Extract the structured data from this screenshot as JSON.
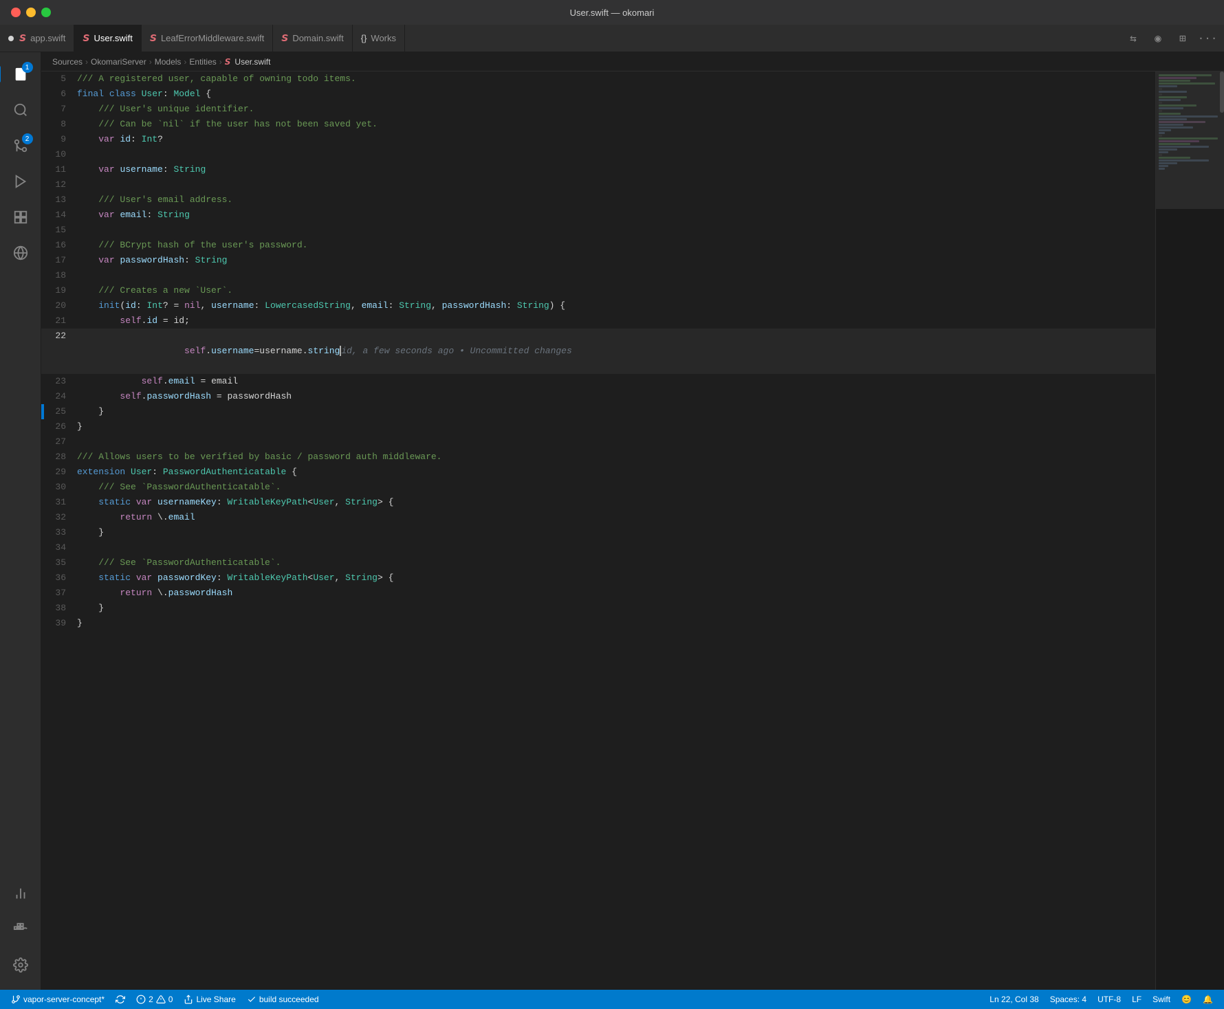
{
  "titleBar": {
    "title": "User.swift — okomari"
  },
  "tabs": [
    {
      "id": "app",
      "label": "app.swift",
      "icon": "swift",
      "dirty": true,
      "active": false
    },
    {
      "id": "user",
      "label": "User.swift",
      "icon": "swift",
      "dirty": false,
      "active": true
    },
    {
      "id": "leaferror",
      "label": "LeafErrorMiddleware.swift",
      "icon": "swift",
      "dirty": false,
      "active": false
    },
    {
      "id": "domain",
      "label": "Domain.swift",
      "icon": "swift",
      "dirty": false,
      "active": false
    },
    {
      "id": "works",
      "label": "Works",
      "icon": "braces",
      "dirty": false,
      "active": false
    }
  ],
  "breadcrumb": {
    "items": [
      "Sources",
      "OkomariServer",
      "Models",
      "Entities",
      "User.swift"
    ]
  },
  "activityBar": {
    "items": [
      {
        "id": "explorer",
        "icon": "📄",
        "badge": "1",
        "active": true
      },
      {
        "id": "search",
        "icon": "🔍",
        "badge": null,
        "active": false
      },
      {
        "id": "git",
        "icon": "⎇",
        "badge": "2",
        "active": false
      },
      {
        "id": "debug",
        "icon": "🔴",
        "badge": null,
        "active": false
      },
      {
        "id": "extensions",
        "icon": "⊞",
        "badge": null,
        "active": false
      },
      {
        "id": "remote",
        "icon": "🌐",
        "badge": null,
        "active": false
      }
    ],
    "bottom": [
      {
        "id": "settings",
        "icon": "⚙",
        "active": false
      }
    ]
  },
  "code": {
    "lines": [
      {
        "num": 5,
        "tokens": [
          {
            "t": "comment",
            "v": "/// A registered user, capable of owning todo items."
          }
        ]
      },
      {
        "num": 6,
        "tokens": [
          {
            "t": "kw2",
            "v": "final "
          },
          {
            "t": "kw2",
            "v": "class "
          },
          {
            "t": "type",
            "v": "User"
          },
          {
            "t": "plain",
            "v": ": "
          },
          {
            "t": "type",
            "v": "Model"
          },
          {
            "t": "plain",
            "v": " {"
          }
        ]
      },
      {
        "num": 7,
        "tokens": [
          {
            "t": "comment",
            "v": "    /// User's unique identifier."
          }
        ]
      },
      {
        "num": 8,
        "tokens": [
          {
            "t": "comment",
            "v": "    /// Can be `nil` if the user has not been saved yet."
          }
        ]
      },
      {
        "num": 9,
        "tokens": [
          {
            "t": "plain",
            "v": "    "
          },
          {
            "t": "kw",
            "v": "var "
          },
          {
            "t": "prop",
            "v": "id"
          },
          {
            "t": "plain",
            "v": ": "
          },
          {
            "t": "type",
            "v": "Int"
          },
          {
            "t": "plain",
            "v": "?"
          }
        ]
      },
      {
        "num": 10,
        "tokens": []
      },
      {
        "num": 11,
        "tokens": [
          {
            "t": "plain",
            "v": "    "
          },
          {
            "t": "kw",
            "v": "var "
          },
          {
            "t": "prop",
            "v": "username"
          },
          {
            "t": "plain",
            "v": ": "
          },
          {
            "t": "type",
            "v": "String"
          }
        ]
      },
      {
        "num": 12,
        "tokens": []
      },
      {
        "num": 13,
        "tokens": [
          {
            "t": "comment",
            "v": "    /// User's email address."
          }
        ]
      },
      {
        "num": 14,
        "tokens": [
          {
            "t": "plain",
            "v": "    "
          },
          {
            "t": "kw",
            "v": "var "
          },
          {
            "t": "prop",
            "v": "email"
          },
          {
            "t": "plain",
            "v": ": "
          },
          {
            "t": "type",
            "v": "String"
          }
        ]
      },
      {
        "num": 15,
        "tokens": []
      },
      {
        "num": 16,
        "tokens": [
          {
            "t": "comment",
            "v": "    /// BCrypt hash of the user's password."
          }
        ]
      },
      {
        "num": 17,
        "tokens": [
          {
            "t": "plain",
            "v": "    "
          },
          {
            "t": "kw",
            "v": "var "
          },
          {
            "t": "prop",
            "v": "passwordHash"
          },
          {
            "t": "plain",
            "v": ": "
          },
          {
            "t": "type",
            "v": "String"
          }
        ]
      },
      {
        "num": 18,
        "tokens": []
      },
      {
        "num": 19,
        "tokens": [
          {
            "t": "comment",
            "v": "    /// Creates a new `User`."
          }
        ]
      },
      {
        "num": 20,
        "tokens": [
          {
            "t": "plain",
            "v": "    "
          },
          {
            "t": "kw2",
            "v": "init"
          },
          {
            "t": "plain",
            "v": "("
          },
          {
            "t": "param",
            "v": "id"
          },
          {
            "t": "plain",
            "v": ": "
          },
          {
            "t": "type",
            "v": "Int"
          },
          {
            "t": "plain",
            "v": "? = "
          },
          {
            "t": "kw",
            "v": "nil"
          },
          {
            "t": "plain",
            "v": ", "
          },
          {
            "t": "param",
            "v": "username"
          },
          {
            "t": "plain",
            "v": ": "
          },
          {
            "t": "type",
            "v": "LowercasedString"
          },
          {
            "t": "plain",
            "v": ", "
          },
          {
            "t": "param",
            "v": "email"
          },
          {
            "t": "plain",
            "v": ": "
          },
          {
            "t": "type",
            "v": "String"
          },
          {
            "t": "plain",
            "v": ", "
          },
          {
            "t": "param",
            "v": "passwordHash"
          },
          {
            "t": "plain",
            "v": ": "
          },
          {
            "t": "type",
            "v": "String"
          },
          {
            "t": "plain",
            "v": ") {"
          }
        ]
      },
      {
        "num": 21,
        "tokens": [
          {
            "t": "plain",
            "v": "        "
          },
          {
            "t": "kw",
            "v": "self"
          },
          {
            "t": "plain",
            "v": "."
          },
          {
            "t": "prop",
            "v": "id"
          },
          {
            "t": "plain",
            "v": " = id;"
          }
        ]
      },
      {
        "num": 22,
        "active": true,
        "tokens": [
          {
            "t": "plain",
            "v": "        "
          },
          {
            "t": "kw",
            "v": "self"
          },
          {
            "t": "plain",
            "v": "."
          },
          {
            "t": "prop",
            "v": "username"
          },
          {
            "t": "plain",
            "v": "=username."
          },
          {
            "t": "prop",
            "v": "string"
          },
          {
            "t": "cursor",
            "v": ""
          },
          {
            "t": "ghost",
            "v": "id, a few seconds ago • Uncommitted changes"
          }
        ]
      },
      {
        "num": 23,
        "tokens": [
          {
            "t": "plain",
            "v": "            "
          },
          {
            "t": "kw",
            "v": "self"
          },
          {
            "t": "plain",
            "v": "."
          },
          {
            "t": "prop",
            "v": "email"
          },
          {
            "t": "plain",
            "v": " = email"
          }
        ]
      },
      {
        "num": 24,
        "tokens": [
          {
            "t": "plain",
            "v": "        "
          },
          {
            "t": "kw",
            "v": "self"
          },
          {
            "t": "plain",
            "v": "."
          },
          {
            "t": "prop",
            "v": "passwordHash"
          },
          {
            "t": "plain",
            "v": " = passwordHash"
          }
        ]
      },
      {
        "num": 25,
        "tokens": [
          {
            "t": "plain",
            "v": "    }"
          }
        ],
        "gutter": true
      },
      {
        "num": 26,
        "tokens": [
          {
            "t": "plain",
            "v": "}"
          }
        ]
      },
      {
        "num": 27,
        "tokens": []
      },
      {
        "num": 28,
        "tokens": [
          {
            "t": "comment",
            "v": "/// Allows users to be verified by basic / password auth middleware."
          }
        ]
      },
      {
        "num": 29,
        "tokens": [
          {
            "t": "kw2",
            "v": "extension "
          },
          {
            "t": "type",
            "v": "User"
          },
          {
            "t": "plain",
            "v": ": "
          },
          {
            "t": "type",
            "v": "PasswordAuthenticatable"
          },
          {
            "t": "plain",
            "v": " {"
          }
        ]
      },
      {
        "num": 30,
        "tokens": [
          {
            "t": "comment",
            "v": "    /// See `PasswordAuthenticatable`."
          }
        ]
      },
      {
        "num": 31,
        "tokens": [
          {
            "t": "plain",
            "v": "    "
          },
          {
            "t": "kw2",
            "v": "static "
          },
          {
            "t": "kw",
            "v": "var "
          },
          {
            "t": "prop",
            "v": "usernameKey"
          },
          {
            "t": "plain",
            "v": ": "
          },
          {
            "t": "type",
            "v": "WritableKeyPath"
          },
          {
            "t": "plain",
            "v": "<"
          },
          {
            "t": "type",
            "v": "User"
          },
          {
            "t": "plain",
            "v": ", "
          },
          {
            "t": "type",
            "v": "String"
          },
          {
            "t": "plain",
            "v": "> {"
          }
        ]
      },
      {
        "num": 32,
        "tokens": [
          {
            "t": "plain",
            "v": "        "
          },
          {
            "t": "kw",
            "v": "return "
          },
          {
            "t": "plain",
            "v": "\\."
          },
          {
            "t": "prop",
            "v": "email"
          }
        ]
      },
      {
        "num": 33,
        "tokens": [
          {
            "t": "plain",
            "v": "    }"
          }
        ]
      },
      {
        "num": 34,
        "tokens": []
      },
      {
        "num": 35,
        "tokens": [
          {
            "t": "comment",
            "v": "    /// See `PasswordAuthenticatable`."
          }
        ]
      },
      {
        "num": 36,
        "tokens": [
          {
            "t": "plain",
            "v": "    "
          },
          {
            "t": "kw2",
            "v": "static "
          },
          {
            "t": "kw",
            "v": "var "
          },
          {
            "t": "prop",
            "v": "passwordKey"
          },
          {
            "t": "plain",
            "v": ": "
          },
          {
            "t": "type",
            "v": "WritableKeyPath"
          },
          {
            "t": "plain",
            "v": "<"
          },
          {
            "t": "type",
            "v": "User"
          },
          {
            "t": "plain",
            "v": ", "
          },
          {
            "t": "type",
            "v": "String"
          },
          {
            "t": "plain",
            "v": "> {"
          }
        ]
      },
      {
        "num": 37,
        "tokens": [
          {
            "t": "plain",
            "v": "        "
          },
          {
            "t": "kw",
            "v": "return "
          },
          {
            "t": "plain",
            "v": "\\."
          },
          {
            "t": "prop",
            "v": "passwordHash"
          }
        ]
      },
      {
        "num": 38,
        "tokens": [
          {
            "t": "plain",
            "v": "    }"
          }
        ]
      },
      {
        "num": 39,
        "tokens": [
          {
            "t": "plain",
            "v": "}"
          }
        ]
      }
    ]
  },
  "statusBar": {
    "branch": "vapor-server-concept*",
    "sync": "",
    "errors": "2",
    "warnings": "0",
    "liveShare": "Live Share",
    "buildStatus": "build succeeded",
    "position": "Ln 22, Col 38",
    "spaces": "Spaces: 4",
    "encoding": "UTF-8",
    "lineEnding": "LF",
    "language": "Swift",
    "smiley": "😊",
    "bell": "🔔"
  }
}
